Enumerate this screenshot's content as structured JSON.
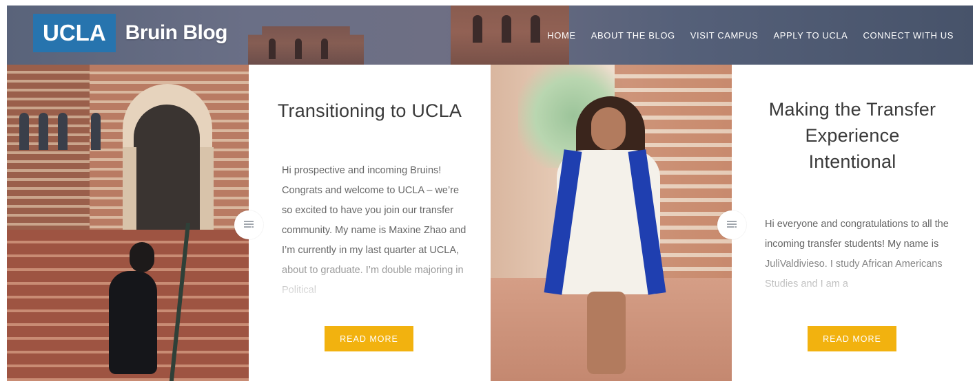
{
  "header": {
    "logo_box": "UCLA",
    "logo_text": "Bruin Blog",
    "brand_color": "#2774ae",
    "nav": [
      {
        "label": "HOME"
      },
      {
        "label": "ABOUT THE BLOG"
      },
      {
        "label": "VISIT CAMPUS"
      },
      {
        "label": "APPLY TO UCLA"
      },
      {
        "label": "CONNECT WITH US"
      }
    ]
  },
  "posts": [
    {
      "title": "Transitioning to UCLA",
      "excerpt": "Hi prospective and incoming Bruins! Congrats and welcome to UCLA – we’re so excited to have you join our transfer community. My name is Maxine Zhao and I’m currently in my last quarter at UCLA, about to graduate. I’m double majoring in Political",
      "read_more": "READ MORE",
      "icon": "post-format-icon"
    },
    {
      "title": "Making the Transfer Experience Intentional",
      "excerpt": "Hi everyone and congratulations to all the incoming transfer students! My name is JuliValdivieso. I study African Americans Studies and I am a",
      "read_more": "READ MORE",
      "icon": "post-format-icon"
    }
  ],
  "colors": {
    "button": "#f2b20f",
    "title_text": "#3a3a3a",
    "excerpt_text": "#666666"
  }
}
